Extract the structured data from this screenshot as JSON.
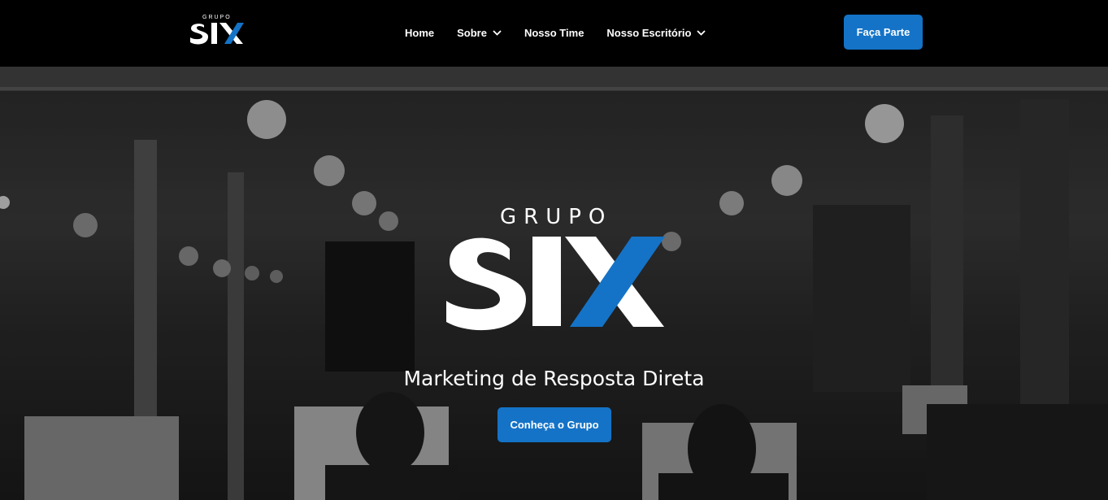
{
  "brand": {
    "small_top": "GRUPO",
    "hero_top": "GRUPO",
    "accent": "#1473c7"
  },
  "nav": {
    "items": [
      {
        "label": "Home",
        "dropdown": false
      },
      {
        "label": "Sobre",
        "dropdown": true
      },
      {
        "label": "Nosso Time",
        "dropdown": false
      },
      {
        "label": "Nosso Escritório",
        "dropdown": true
      }
    ],
    "cta_label": "Faça Parte"
  },
  "hero": {
    "tagline": "Marketing de Resposta Direta",
    "cta_label": "Conheça o Grupo"
  }
}
